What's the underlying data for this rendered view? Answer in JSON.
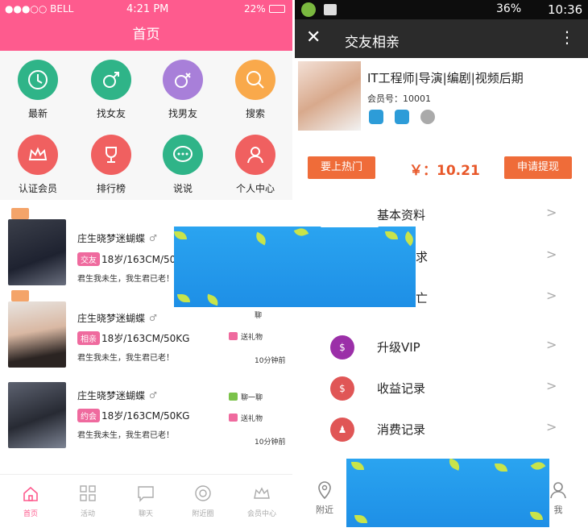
{
  "left": {
    "status": {
      "carrier": "●●●○○ BELL",
      "time": "4:21 PM",
      "battery": "22%"
    },
    "title": "首页",
    "grid": [
      {
        "label": "最新",
        "color": "#2fb488",
        "icon": "clock-icon"
      },
      {
        "label": "找女友",
        "color": "#2fb488",
        "icon": "male-icon"
      },
      {
        "label": "找男友",
        "color": "#a87fd9",
        "icon": "female-icon"
      },
      {
        "label": "搜索",
        "color": "#f9a94b",
        "icon": "search-icon"
      },
      {
        "label": "认证会员",
        "color": "#f06060",
        "icon": "crown-icon"
      },
      {
        "label": "排行榜",
        "color": "#f06060",
        "icon": "trophy-icon"
      },
      {
        "label": "说说",
        "color": "#2fb488",
        "icon": "chat-icon"
      },
      {
        "label": "个人中心",
        "color": "#f06060",
        "icon": "user-icon"
      }
    ],
    "items": [
      {
        "name": "庄生晓梦迷蝴蝶",
        "gender": "♂",
        "tag": "交友",
        "tag_color": "#ef6a9e",
        "info": "18岁/163CM/50KG",
        "motto": "君生我未生，我生君已老！",
        "chat": "",
        "gift": "",
        "time": ""
      },
      {
        "name": "庄生晓梦迷蝴蝶",
        "gender": "♂",
        "tag": "相亲",
        "tag_color": "#ef6a9e",
        "info": "18岁/163CM/50KG",
        "motto": "君生我未生，我生君已老！",
        "chat": "聊",
        "gift": "送礼物",
        "time": "10分钟前"
      },
      {
        "name": "庄生晓梦迷蝴蝶",
        "gender": "♂",
        "tag": "约会",
        "tag_color": "#ef6a9e",
        "info": "18岁/163CM/50KG",
        "motto": "君生我未生，我生君已老！",
        "chat": "聊一聊",
        "gift": "送礼物",
        "time": "10分钟前"
      }
    ],
    "tabs": [
      {
        "label": "首页",
        "active": true
      },
      {
        "label": "活动",
        "active": false
      },
      {
        "label": "聊天",
        "active": false
      },
      {
        "label": "附近圈",
        "active": false
      },
      {
        "label": "会员中心",
        "active": false
      }
    ]
  },
  "right": {
    "status": {
      "battery": "36%",
      "time": "10:36"
    },
    "title": "交友相亲",
    "profile": {
      "name": "IT工程师|导演|编剧|视频后期",
      "member_id": "会员号：10001"
    },
    "hot_button": "要上热门",
    "balance": "￥：10.21",
    "withdraw_button": "申请提现",
    "menu": [
      {
        "label": "基本资料",
        "color": "",
        "icon": ""
      },
      {
        "label": "求",
        "color": "",
        "icon": ""
      },
      {
        "label": "亡",
        "color": "",
        "icon": ""
      },
      {
        "label": "升级VIP",
        "color": "#9b2fa8",
        "icon": "vip-icon"
      },
      {
        "label": "收益记录",
        "color": "#e05656",
        "icon": "income-icon"
      },
      {
        "label": "消费记录",
        "color": "#e05656",
        "icon": "expense-icon"
      }
    ],
    "tabs": [
      {
        "label": "附近"
      },
      {
        "label": "我"
      }
    ],
    "arrow": ">"
  }
}
